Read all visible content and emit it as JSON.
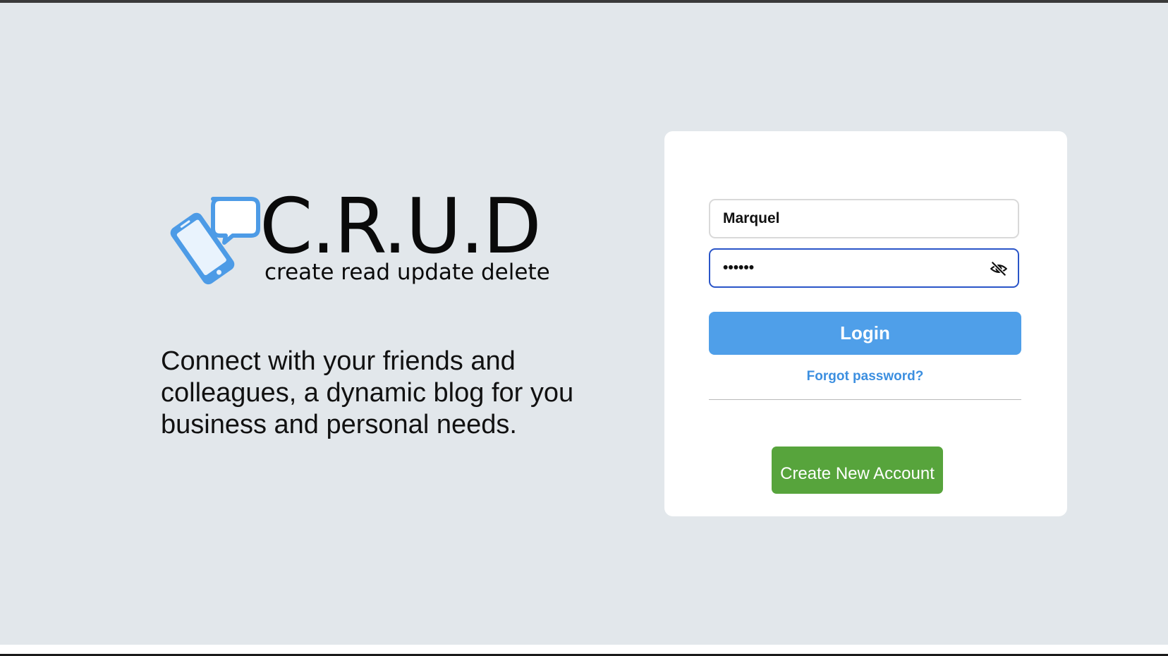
{
  "brand": {
    "name": "C.R.U.D",
    "tagline": "create read update delete",
    "icon": "phone-chat-logo-icon",
    "accent_color": "#4f9fe9"
  },
  "intro": {
    "text": "Connect with your friends and colleagues, a dynamic blog for you business and personal needs."
  },
  "login_form": {
    "username_value": "Marquel",
    "password_value": "••••••",
    "password_toggle_icon": "eye-off-icon",
    "login_label": "Login",
    "login_color": "#4f9fe9",
    "forgot_label": "Forgot password?",
    "create_account_label": "Create New Account",
    "create_account_color": "#57a43c"
  }
}
